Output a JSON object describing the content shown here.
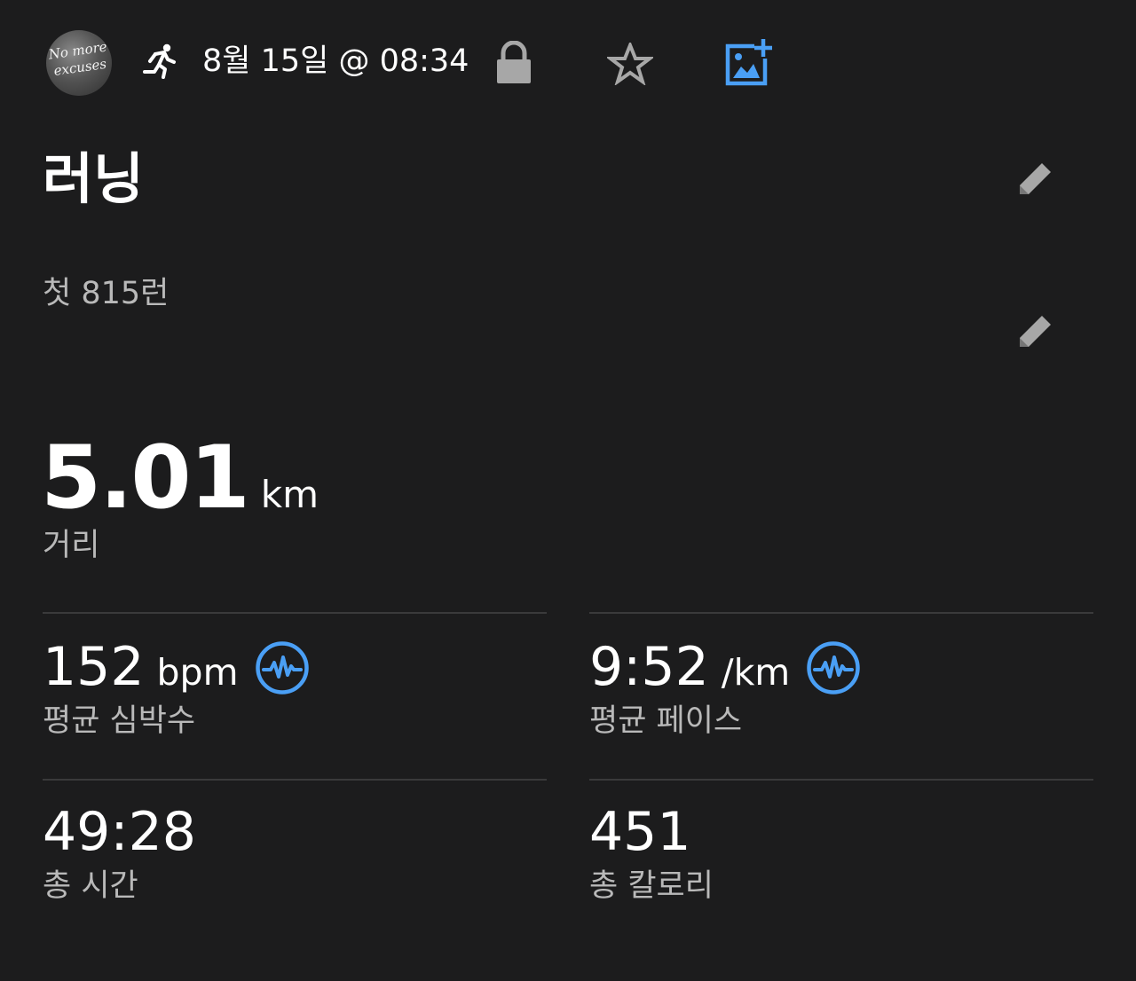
{
  "header": {
    "avatar_text_line1": "No more",
    "avatar_text_line2": "excuses",
    "activity_icon": "running-icon",
    "datetime": "8월 15일 @ 08:34",
    "privacy_icon": "lock-icon",
    "favorite_icon": "star-icon",
    "add_photo_icon": "add-photo-icon",
    "accent_color": "#4a9ff5"
  },
  "activity": {
    "title": "러닝",
    "description": "첫 815런"
  },
  "distance": {
    "value": "5.01",
    "unit": "km",
    "label": "거리"
  },
  "stats": {
    "heart_rate": {
      "value": "152",
      "unit": "bpm",
      "label": "평균 심박수",
      "icon": "pulse-icon"
    },
    "pace": {
      "value": "9:52",
      "unit": "/km",
      "label": "평균 페이스",
      "icon": "pulse-icon"
    },
    "total_time": {
      "value": "49:28",
      "label": "총 시간"
    },
    "calories": {
      "value": "451",
      "label": "총 칼로리"
    }
  }
}
